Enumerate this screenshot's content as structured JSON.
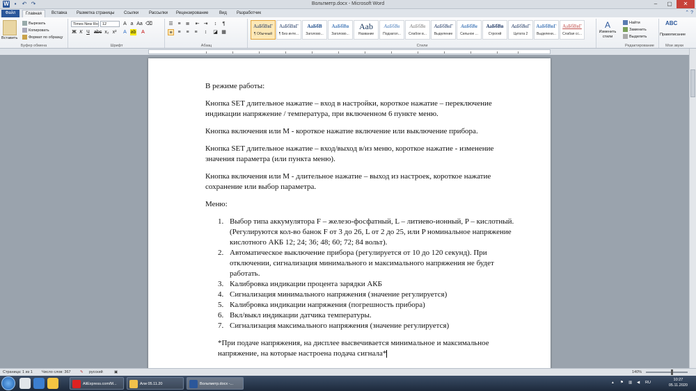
{
  "window": {
    "title": "Вольтметр.docx - Microsoft Word",
    "min": "–",
    "max": "▢",
    "close": "✕"
  },
  "tabs": [
    "Файл",
    "Главная",
    "Вставка",
    "Разметка страницы",
    "Ссылки",
    "Рассылки",
    "Рецензирование",
    "Вид",
    "Разработчик"
  ],
  "ribbon": {
    "clipboard": {
      "label": "Буфер обмена",
      "paste": "Вставить",
      "cut": "Вырезать",
      "copy": "Копировать",
      "format_painter": "Формат по образцу"
    },
    "font": {
      "label": "Шрифт",
      "family": "Times New Ro",
      "size": "12"
    },
    "paragraph": {
      "label": "Абзац"
    },
    "styles": {
      "label": "Стили",
      "items": [
        {
          "sample": "АаБбВвГ",
          "name": "¶ Обычный"
        },
        {
          "sample": "АаБбВвГ",
          "name": "¶ Без инте..."
        },
        {
          "sample": "АаБбВ",
          "name": "Заголово..."
        },
        {
          "sample": "АаБбВв",
          "name": "Заголово..."
        },
        {
          "sample": "Aab",
          "name": "Название"
        },
        {
          "sample": "АаБбВв",
          "name": "Подзагол..."
        },
        {
          "sample": "АаБбВв",
          "name": "Слабое в..."
        },
        {
          "sample": "АаБбВвГ",
          "name": "Выделение"
        },
        {
          "sample": "АаБбВв",
          "name": "Сильное ..."
        },
        {
          "sample": "АаБбВв",
          "name": "Строгий"
        },
        {
          "sample": "АаБбВвГ",
          "name": "Цитата 2"
        },
        {
          "sample": "АаБбВвГ",
          "name": "Выделени..."
        },
        {
          "sample": "АаБбВвГ",
          "name": "Слабая сс..."
        }
      ],
      "change": "Изменить стили"
    },
    "editing": {
      "label": "Редактирование",
      "find": "Найти",
      "replace": "Заменить",
      "select": "Выделить"
    },
    "proofing": {
      "label": "Мои звуки",
      "spelling": "Правописание"
    }
  },
  "document": {
    "p1": "В режиме работы:",
    "p2": "Кнопка SET длительное нажатие – вход в настройки, короткое нажатие – переключение индикации напряжение / температура, при включенном 6 пункте меню.",
    "p3": "Кнопка включения или М - короткое нажатие включение или выключение прибора.",
    "p4": "Кнопка SET длительное нажатие – вход/выход в/из меню, короткое нажатие - изменение значения параметра (или пункта меню).",
    "p5": "Кнопка включения или М - длительное нажатие – выход из настроек, короткое нажатие сохранение или выбор параметра.",
    "p6": "Меню:",
    "menu": [
      {
        "num": "1.",
        "text": "Выбор типа аккумулятора F – железо-фосфатный, L – литиево-ионный, P – кислотный. (Регулируются кол-во банок F от 3 до 26, L от 2 до 25, или P номинальное напряжение кислотного АКБ 12; 24; 36; 48; 60; 72; 84 вольт)."
      },
      {
        "num": "2.",
        "text": "Автоматическое выключение прибора (регулируется от 10 до 120 секунд). При отключении, сигнализация минимального и максимального напряжения не будет работать."
      },
      {
        "num": "3.",
        "text": "Калибровка индикации процента зарядки АКБ"
      },
      {
        "num": "4.",
        "text": "Сигнализация минимального напряжения (значение регулируется)"
      },
      {
        "num": "5.",
        "text": "Калибровка индикации напряжения (погрешность прибора)"
      },
      {
        "num": "6.",
        "text": "Вкл/выкл индикации датчика температуры."
      },
      {
        "num": "7.",
        "text": "Сигнализация максимального напряжения (значение регулируется)"
      }
    ],
    "note": "*При подаче напряжения, на дисплее высвечивается минимальное и максимальное напряжение, на которые настроена подача сигнала*"
  },
  "status": {
    "page": "Страница: 1 из 1",
    "words": "Число слов: 367",
    "lang": "русский",
    "zoom": "140%",
    "zoom_fraction": 0.64
  },
  "taskbar": {
    "tasks": [
      "AliExpress.com/M...",
      "Али 05.11.20",
      "Вольтметр.docx -..."
    ],
    "lang": "RU",
    "time": "10:27",
    "date": "05.11.2020"
  }
}
